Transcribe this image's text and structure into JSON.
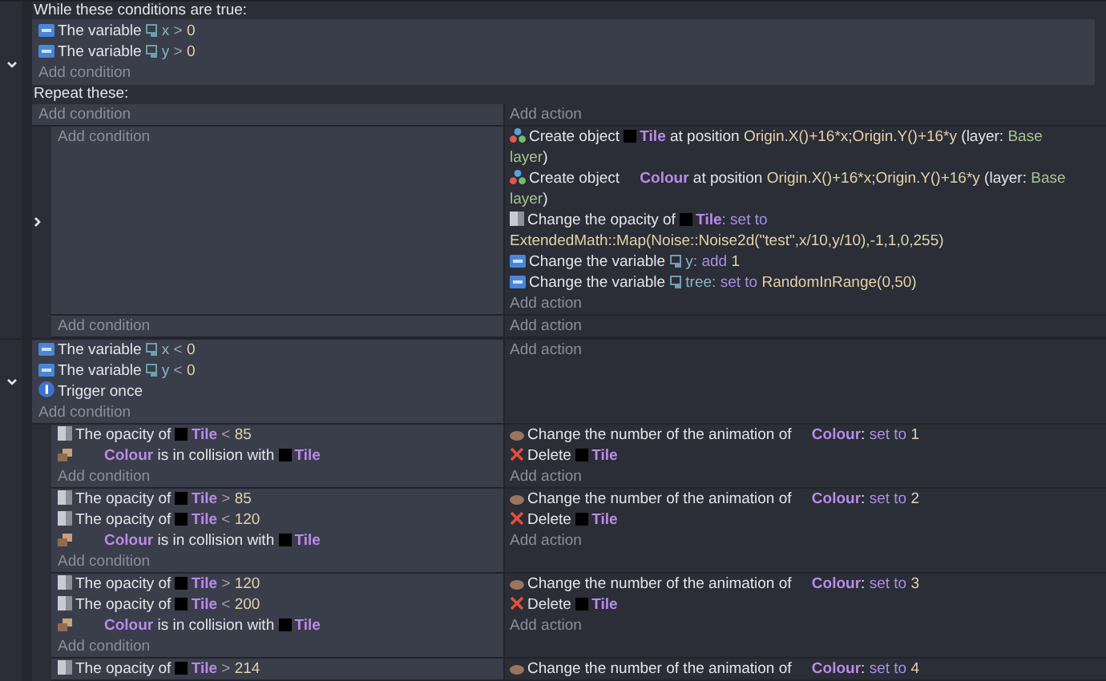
{
  "events": [
    {
      "expanded": true,
      "while": {
        "title": "While these conditions are true:",
        "conditions": [
          {
            "kind": "variable",
            "parts": [
              {
                "text": "The variable ",
                "kind": "text"
              },
              {
                "text": "x",
                "kind": "variable"
              },
              {
                "text": " > ",
                "kind": "operator"
              },
              {
                "text": "0",
                "kind": "value"
              }
            ]
          },
          {
            "kind": "variable",
            "parts": [
              {
                "text": "The variable ",
                "kind": "text"
              },
              {
                "text": "y",
                "kind": "variable"
              },
              {
                "text": " > ",
                "kind": "operator"
              },
              {
                "text": "0",
                "kind": "value"
              }
            ]
          }
        ],
        "add_condition": "Add condition",
        "repeat_label": "Repeat these:"
      },
      "add_condition": "Add condition",
      "add_action": "Add action",
      "children": [
        {
          "expanded": false,
          "add_condition": "Add condition",
          "actions": [
            {
              "kind": "create",
              "parts": [
                {
                  "text": "Create object ",
                  "kind": "text"
                },
                {
                  "text": "Tile",
                  "kind": "object",
                  "thumb": true
                },
                {
                  "text": " at position ",
                  "kind": "text"
                },
                {
                  "text": "Origin.X()+16*x;Origin.Y()+16*y",
                  "kind": "value"
                },
                {
                  "text": " (layer: ",
                  "kind": "text"
                },
                {
                  "text": "Base ",
                  "kind": "layer"
                },
                {
                  "text": "layer",
                  "kind": "layer"
                },
                {
                  "text": ")",
                  "kind": "text"
                }
              ]
            },
            {
              "kind": "create",
              "parts": [
                {
                  "text": "Create object ",
                  "kind": "text"
                },
                {
                  "text": "Colour",
                  "kind": "object",
                  "thumb": false
                },
                {
                  "text": " at position ",
                  "kind": "text"
                },
                {
                  "text": "Origin.X()+16*x;Origin.Y()+16*y",
                  "kind": "value"
                },
                {
                  "text": " (layer: ",
                  "kind": "text"
                },
                {
                  "text": "Base ",
                  "kind": "layer"
                },
                {
                  "text": "layer",
                  "kind": "layer"
                },
                {
                  "text": ")",
                  "kind": "text"
                }
              ]
            },
            {
              "kind": "opacity",
              "parts": [
                {
                  "text": "Change the opacity of ",
                  "kind": "text"
                },
                {
                  "text": "Tile",
                  "kind": "object",
                  "thumb": true
                },
                {
                  "text": ": set to ",
                  "kind": "keyword"
                },
                {
                  "text": "ExtendedMath::Map(Noise::Noise2d(\"test\",x/10,y/10),-1,1,0,255)",
                  "kind": "value"
                }
              ]
            },
            {
              "kind": "variable",
              "parts": [
                {
                  "text": "Change the variable ",
                  "kind": "text"
                },
                {
                  "text": "y",
                  "kind": "variable"
                },
                {
                  "text": ": add ",
                  "kind": "keyword"
                },
                {
                  "text": "1",
                  "kind": "value"
                }
              ]
            },
            {
              "kind": "variable",
              "parts": [
                {
                  "text": "Change the variable ",
                  "kind": "text"
                },
                {
                  "text": "tree",
                  "kind": "variable"
                },
                {
                  "text": ": set to ",
                  "kind": "keyword"
                },
                {
                  "text": "RandomInRange(0,50)",
                  "kind": "value"
                }
              ]
            }
          ],
          "add_action": "Add action"
        },
        {
          "add_condition": "Add condition",
          "add_action": "Add action"
        }
      ]
    },
    {
      "expanded": true,
      "conditions": [
        {
          "kind": "variable",
          "parts": [
            {
              "text": "The variable ",
              "kind": "text"
            },
            {
              "text": "x",
              "kind": "variable"
            },
            {
              "text": " < ",
              "kind": "operator"
            },
            {
              "text": "0",
              "kind": "value"
            }
          ]
        },
        {
          "kind": "variable",
          "parts": [
            {
              "text": "The variable ",
              "kind": "text"
            },
            {
              "text": "y",
              "kind": "variable"
            },
            {
              "text": " < ",
              "kind": "operator"
            },
            {
              "text": "0",
              "kind": "value"
            }
          ]
        },
        {
          "kind": "trigger",
          "parts": [
            {
              "text": "Trigger once",
              "kind": "text"
            }
          ]
        }
      ],
      "add_condition": "Add condition",
      "add_action": "Add action",
      "children": [
        {
          "conditions": [
            {
              "kind": "opacity",
              "parts": [
                {
                  "text": "The opacity of ",
                  "kind": "text"
                },
                {
                  "text": "Tile",
                  "kind": "object",
                  "thumb": true
                },
                {
                  "text": " < ",
                  "kind": "operator"
                },
                {
                  "text": "85",
                  "kind": "value"
                }
              ]
            },
            {
              "kind": "collision",
              "parts": [
                {
                  "text": "Colour",
                  "kind": "object",
                  "thumb": false
                },
                {
                  "text": " is in collision with ",
                  "kind": "text"
                },
                {
                  "text": "Tile",
                  "kind": "object",
                  "thumb": true
                }
              ]
            }
          ],
          "add_condition": "Add condition",
          "actions": [
            {
              "kind": "animation",
              "parts": [
                {
                  "text": "Change the number of the animation of ",
                  "kind": "text"
                },
                {
                  "text": "Colour",
                  "kind": "object",
                  "thumb": false
                },
                {
                  "text": ": ",
                  "kind": "text"
                },
                {
                  "text": "set to ",
                  "kind": "keyword"
                },
                {
                  "text": "1",
                  "kind": "value"
                }
              ]
            },
            {
              "kind": "delete",
              "parts": [
                {
                  "text": "Delete ",
                  "kind": "text"
                },
                {
                  "text": "Tile",
                  "kind": "object",
                  "thumb": true
                }
              ]
            }
          ],
          "add_action": "Add action"
        },
        {
          "conditions": [
            {
              "kind": "opacity",
              "parts": [
                {
                  "text": "The opacity of ",
                  "kind": "text"
                },
                {
                  "text": "Tile",
                  "kind": "object",
                  "thumb": true
                },
                {
                  "text": " > ",
                  "kind": "operator"
                },
                {
                  "text": "85",
                  "kind": "value"
                }
              ]
            },
            {
              "kind": "opacity",
              "parts": [
                {
                  "text": "The opacity of ",
                  "kind": "text"
                },
                {
                  "text": "Tile",
                  "kind": "object",
                  "thumb": true
                },
                {
                  "text": " < ",
                  "kind": "operator"
                },
                {
                  "text": "120",
                  "kind": "value"
                }
              ]
            },
            {
              "kind": "collision",
              "parts": [
                {
                  "text": "Colour",
                  "kind": "object",
                  "thumb": false
                },
                {
                  "text": " is in collision with ",
                  "kind": "text"
                },
                {
                  "text": "Tile",
                  "kind": "object",
                  "thumb": true
                }
              ]
            }
          ],
          "add_condition": "Add condition",
          "actions": [
            {
              "kind": "animation",
              "parts": [
                {
                  "text": "Change the number of the animation of ",
                  "kind": "text"
                },
                {
                  "text": "Colour",
                  "kind": "object",
                  "thumb": false
                },
                {
                  "text": ": ",
                  "kind": "text"
                },
                {
                  "text": "set to ",
                  "kind": "keyword"
                },
                {
                  "text": "2",
                  "kind": "value"
                }
              ]
            },
            {
              "kind": "delete",
              "parts": [
                {
                  "text": "Delete ",
                  "kind": "text"
                },
                {
                  "text": "Tile",
                  "kind": "object",
                  "thumb": true
                }
              ]
            }
          ],
          "add_action": "Add action"
        },
        {
          "conditions": [
            {
              "kind": "opacity",
              "parts": [
                {
                  "text": "The opacity of ",
                  "kind": "text"
                },
                {
                  "text": "Tile",
                  "kind": "object",
                  "thumb": true
                },
                {
                  "text": " > ",
                  "kind": "operator"
                },
                {
                  "text": "120",
                  "kind": "value"
                }
              ]
            },
            {
              "kind": "opacity",
              "parts": [
                {
                  "text": "The opacity of ",
                  "kind": "text"
                },
                {
                  "text": "Tile",
                  "kind": "object",
                  "thumb": true
                },
                {
                  "text": " < ",
                  "kind": "operator"
                },
                {
                  "text": "200",
                  "kind": "value"
                }
              ]
            },
            {
              "kind": "collision",
              "parts": [
                {
                  "text": "Colour",
                  "kind": "object",
                  "thumb": false
                },
                {
                  "text": " is in collision with ",
                  "kind": "text"
                },
                {
                  "text": "Tile",
                  "kind": "object",
                  "thumb": true
                }
              ]
            }
          ],
          "add_condition": "Add condition",
          "actions": [
            {
              "kind": "animation",
              "parts": [
                {
                  "text": "Change the number of the animation of ",
                  "kind": "text"
                },
                {
                  "text": "Colour",
                  "kind": "object",
                  "thumb": false
                },
                {
                  "text": ": ",
                  "kind": "text"
                },
                {
                  "text": "set to ",
                  "kind": "keyword"
                },
                {
                  "text": "3",
                  "kind": "value"
                }
              ]
            },
            {
              "kind": "delete",
              "parts": [
                {
                  "text": "Delete ",
                  "kind": "text"
                },
                {
                  "text": "Tile",
                  "kind": "object",
                  "thumb": true
                }
              ]
            }
          ],
          "add_action": "Add action"
        },
        {
          "conditions": [
            {
              "kind": "opacity",
              "parts": [
                {
                  "text": "The opacity of ",
                  "kind": "text"
                },
                {
                  "text": "Tile",
                  "kind": "object",
                  "thumb": true
                },
                {
                  "text": " > ",
                  "kind": "operator"
                },
                {
                  "text": "214",
                  "kind": "value"
                }
              ]
            }
          ],
          "actions": [
            {
              "kind": "animation",
              "parts": [
                {
                  "text": "Change the number of the animation of ",
                  "kind": "text"
                },
                {
                  "text": "Colour",
                  "kind": "object",
                  "thumb": false
                },
                {
                  "text": ": ",
                  "kind": "text"
                },
                {
                  "text": "set to ",
                  "kind": "keyword"
                },
                {
                  "text": "4",
                  "kind": "value"
                }
              ]
            }
          ]
        }
      ]
    }
  ]
}
